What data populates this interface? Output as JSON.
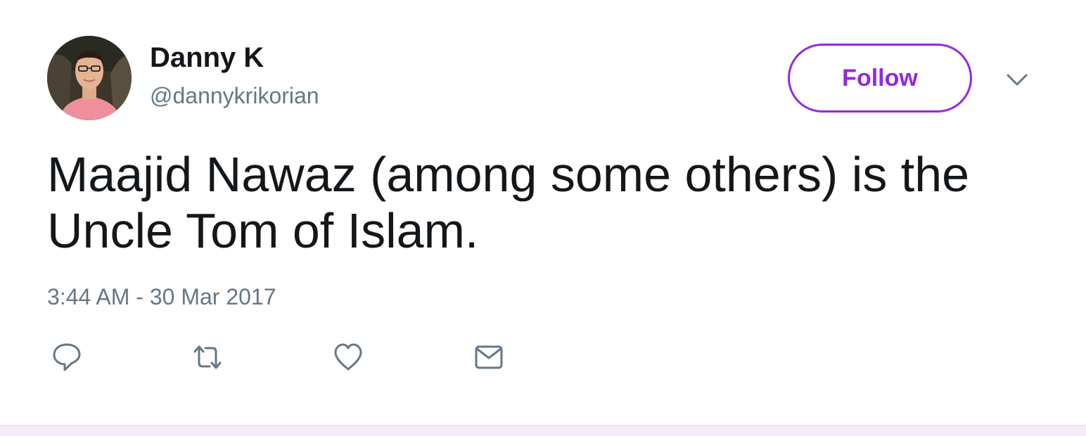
{
  "tweet": {
    "author": {
      "display_name": "Danny K",
      "screen_name": "@dannykrikorian",
      "avatar_icon": "profile-photo"
    },
    "follow_label": "Follow",
    "menu_icon": "chevron-down-icon",
    "text": "Maajid Nawaz (among some others) is the Uncle Tom of Islam.",
    "timestamp": "3:44 AM - 30 Mar 2017",
    "actions": [
      {
        "name": "reply",
        "icon": "reply-icon"
      },
      {
        "name": "retweet",
        "icon": "retweet-icon"
      },
      {
        "name": "like",
        "icon": "heart-icon"
      },
      {
        "name": "direct-message",
        "icon": "envelope-icon"
      }
    ]
  },
  "colors": {
    "accent": "#9428e0",
    "text": "#14171a",
    "secondary_text": "#657786",
    "footer_bg": "#f3ebfa"
  }
}
